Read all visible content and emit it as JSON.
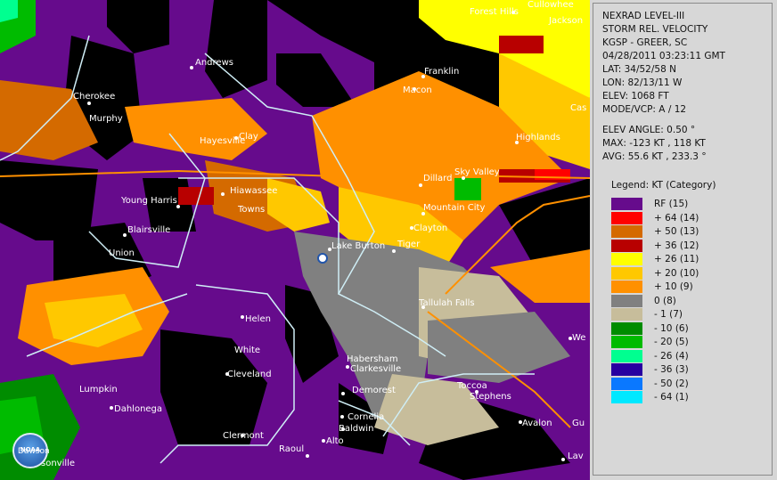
{
  "header": {
    "product_line1": "NEXRAD LEVEL-III",
    "product_line2": "STORM REL. VELOCITY",
    "station": "KGSP - GREER, SC",
    "datetime": "04/28/2011 03:23:11 GMT",
    "lat": "LAT: 34/52/58 N",
    "lon": "LON: 82/13/11 W",
    "elev": "ELEV: 1068 FT",
    "mode": "MODE/VCP: A / 12",
    "elev_angle": "ELEV ANGLE: 0.50 °",
    "max": "MAX: -123 KT , 118 KT",
    "avg": "AVG: 55.6 KT , 233.3 °"
  },
  "legend": {
    "title": "Legend: KT (Category)",
    "items": [
      {
        "label": "RF  (15)",
        "color": "#660b8c"
      },
      {
        "label": "+ 64  (14)",
        "color": "#ff0000"
      },
      {
        "label": "+ 50  (13)",
        "color": "#d46a00"
      },
      {
        "label": "+ 36  (12)",
        "color": "#b80000"
      },
      {
        "label": "+ 26  (11)",
        "color": "#ffff00"
      },
      {
        "label": "+ 20  (10)",
        "color": "#ffc800"
      },
      {
        "label": "+ 10  (9)",
        "color": "#ff9000"
      },
      {
        "label": "0  (8)",
        "color": "#808080"
      },
      {
        "label": "- 1  (7)",
        "color": "#c7bd9b"
      },
      {
        "label": "- 10  (6)",
        "color": "#008c00"
      },
      {
        "label": "- 20  (5)",
        "color": "#00bb00"
      },
      {
        "label": "- 26  (4)",
        "color": "#00ff90"
      },
      {
        "label": "- 36  (3)",
        "color": "#2800a0"
      },
      {
        "label": "- 50  (2)",
        "color": "#0a78ff"
      },
      {
        "label": "- 64  (1)",
        "color": "#00e8ff"
      }
    ]
  },
  "map": {
    "towns": [
      "Forest Hills",
      "Cullowhee",
      "Jackson",
      "Andrews",
      "Franklin",
      "Cherokee",
      "Macon",
      "Murphy",
      "Cas",
      "Clay",
      "Hayesville",
      "Highlands",
      "Sky Valley",
      "Dillard",
      "Hiawassee",
      "Young Harris",
      "Towns",
      "Mountain City",
      "Blairsville",
      "Clayton",
      "Lake Burton",
      "Tiger",
      "Union",
      "Tallulah Falls",
      "Helen",
      "White",
      "We",
      "Habersham",
      "Clarkesville",
      "Cleveland",
      "Lumpkin",
      "Toccoa",
      "Demorest",
      "Stephens",
      "Dahlonega",
      "Cornelia",
      "Avalon",
      "Baldwin",
      "Gu",
      "Clermont",
      "Alto",
      "Raoul",
      "Dawsonville",
      "Lav"
    ],
    "logo_text": "NOAA",
    "logo_label": "Dawson"
  }
}
